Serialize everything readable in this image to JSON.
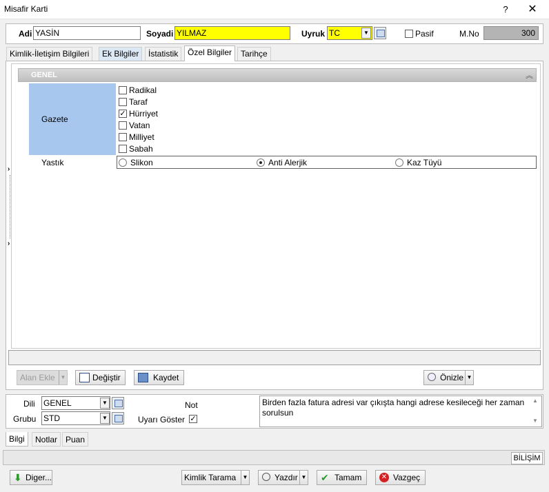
{
  "window": {
    "title": "Misafir Karti",
    "help": "?",
    "close": "✕"
  },
  "header": {
    "adi_label": "Adi",
    "adi_value": "YASİN",
    "soyadi_label": "Soyadi",
    "soyadi_value": "YILMAZ",
    "uyruk_label": "Uyruk",
    "uyruk_value": "TC",
    "pasif_label": "Pasif",
    "pasif_checked": false,
    "mno_label": "M.No",
    "mno_value": "300"
  },
  "tabs": [
    {
      "label": "Kimlik-İletişim Bilgileri"
    },
    {
      "label": "Ek Bilgiler"
    },
    {
      "label": "İstatistik"
    },
    {
      "label": "Özel Bilgiler",
      "active": true
    },
    {
      "label": "Tarihçe"
    }
  ],
  "group": {
    "title": "GENEL",
    "collapse_icon": "double-chevron-up-icon"
  },
  "gazete": {
    "label": "Gazete",
    "options": [
      {
        "label": "Radikal",
        "checked": false
      },
      {
        "label": "Taraf",
        "checked": false
      },
      {
        "label": "Hürriyet",
        "checked": true
      },
      {
        "label": "Vatan",
        "checked": false
      },
      {
        "label": "Milliyet",
        "checked": false
      },
      {
        "label": "Sabah",
        "checked": false
      }
    ]
  },
  "yastik": {
    "label": "Yastık",
    "options": [
      {
        "label": "Slikon",
        "selected": false
      },
      {
        "label": "Anti Alerjik",
        "selected": true
      },
      {
        "label": "Kaz Tüyü",
        "selected": false
      }
    ]
  },
  "toolbar": {
    "alan_ekle": "Alan Ekle",
    "degistir": "Değiştir",
    "kaydet": "Kaydet",
    "onizle": "Önizle"
  },
  "bottom": {
    "dili_label": "Dili",
    "dili_value": "GENEL",
    "grubu_label": "Grubu",
    "grubu_value": "STD",
    "not_label": "Not",
    "uyari_label": "Uyarı Göster",
    "uyari_checked": true,
    "note_text": "Birden fazla fatura adresi var çıkışta hangi adrese kesileceği her zaman sorulsun"
  },
  "bottom_tabs": [
    {
      "label": "Bilgi"
    },
    {
      "label": "Notlar"
    },
    {
      "label": "Puan"
    }
  ],
  "status": {
    "brand": "BİLİŞİM"
  },
  "footer_buttons": {
    "diger": "Diger...",
    "kimlik_tarama": "Kimlik Tarama",
    "yazdir": "Yazdır",
    "tamam": "Tamam",
    "vazgec": "Vazgeç"
  },
  "colors": {
    "yellow": "#ffff00",
    "label_blue": "#a7c7ee",
    "brand_cell": "#ffffff"
  }
}
